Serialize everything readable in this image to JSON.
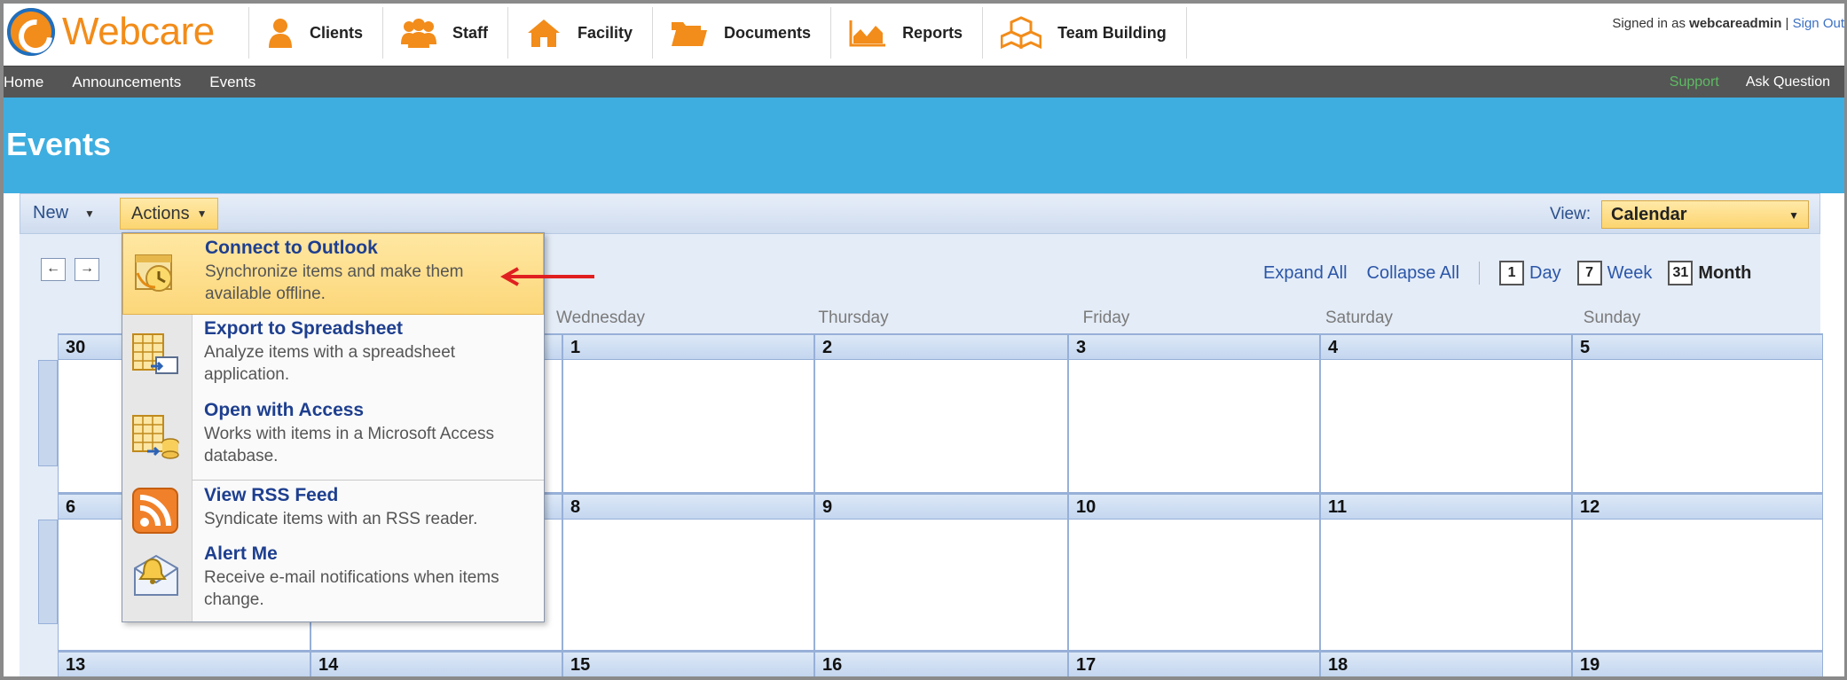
{
  "header": {
    "logo_text": "Webcare",
    "nav": [
      {
        "label": "Clients",
        "icon": "person-icon"
      },
      {
        "label": "Staff",
        "icon": "group-icon"
      },
      {
        "label": "Facility",
        "icon": "house-icon"
      },
      {
        "label": "Documents",
        "icon": "folder-icon"
      },
      {
        "label": "Reports",
        "icon": "chart-icon"
      },
      {
        "label": "Team Building",
        "icon": "boxes-icon"
      }
    ],
    "signed_in_prefix": "Signed in as",
    "username": "webcareadmin",
    "separator": "|",
    "sign_out": "Sign Out"
  },
  "subnav": {
    "items": [
      "Home",
      "Announcements",
      "Events"
    ],
    "support": "Support",
    "ask": "Ask Question"
  },
  "page_title": "Events",
  "toolbar": {
    "new_label": "New",
    "actions_label": "Actions",
    "view_label": "View:",
    "view_value": "Calendar"
  },
  "calendar": {
    "controls": {
      "expand_all": "Expand All",
      "collapse_all": "Collapse All",
      "day": "Day",
      "day_icon_num": "1",
      "week": "Week",
      "week_icon_num": "7",
      "month": "Month",
      "month_icon_num": "31"
    },
    "day_headers": [
      "Wednesday",
      "Thursday",
      "Friday",
      "Saturday",
      "Sunday"
    ],
    "weeks": [
      [
        "30",
        "",
        "1",
        "2",
        "3",
        "4",
        "5"
      ],
      [
        "6",
        "",
        "8",
        "9",
        "10",
        "11",
        "12"
      ],
      [
        "13",
        "14",
        "15",
        "16",
        "17",
        "18",
        "19"
      ]
    ]
  },
  "actions_menu": {
    "items": [
      {
        "title": "Connect to Outlook",
        "desc": "Synchronize items and make them available offline.",
        "icon": "outlook-sync-icon"
      },
      {
        "title": "Export to Spreadsheet",
        "desc": "Analyze items with a spreadsheet application.",
        "icon": "spreadsheet-export-icon"
      },
      {
        "title": "Open with Access",
        "desc": "Works with items in a Microsoft Access database.",
        "icon": "access-database-icon"
      },
      {
        "title": "View RSS Feed",
        "desc": "Syndicate items with an RSS reader.",
        "icon": "rss-icon"
      },
      {
        "title": "Alert Me",
        "desc": "Receive e-mail notifications when items change.",
        "icon": "alert-bell-icon"
      }
    ]
  },
  "colors": {
    "brand_orange": "#f28c1a",
    "title_band": "#3eaee0",
    "subnav_bg": "#555555",
    "highlight": "#fcd77a",
    "arrow": "#e02020"
  }
}
